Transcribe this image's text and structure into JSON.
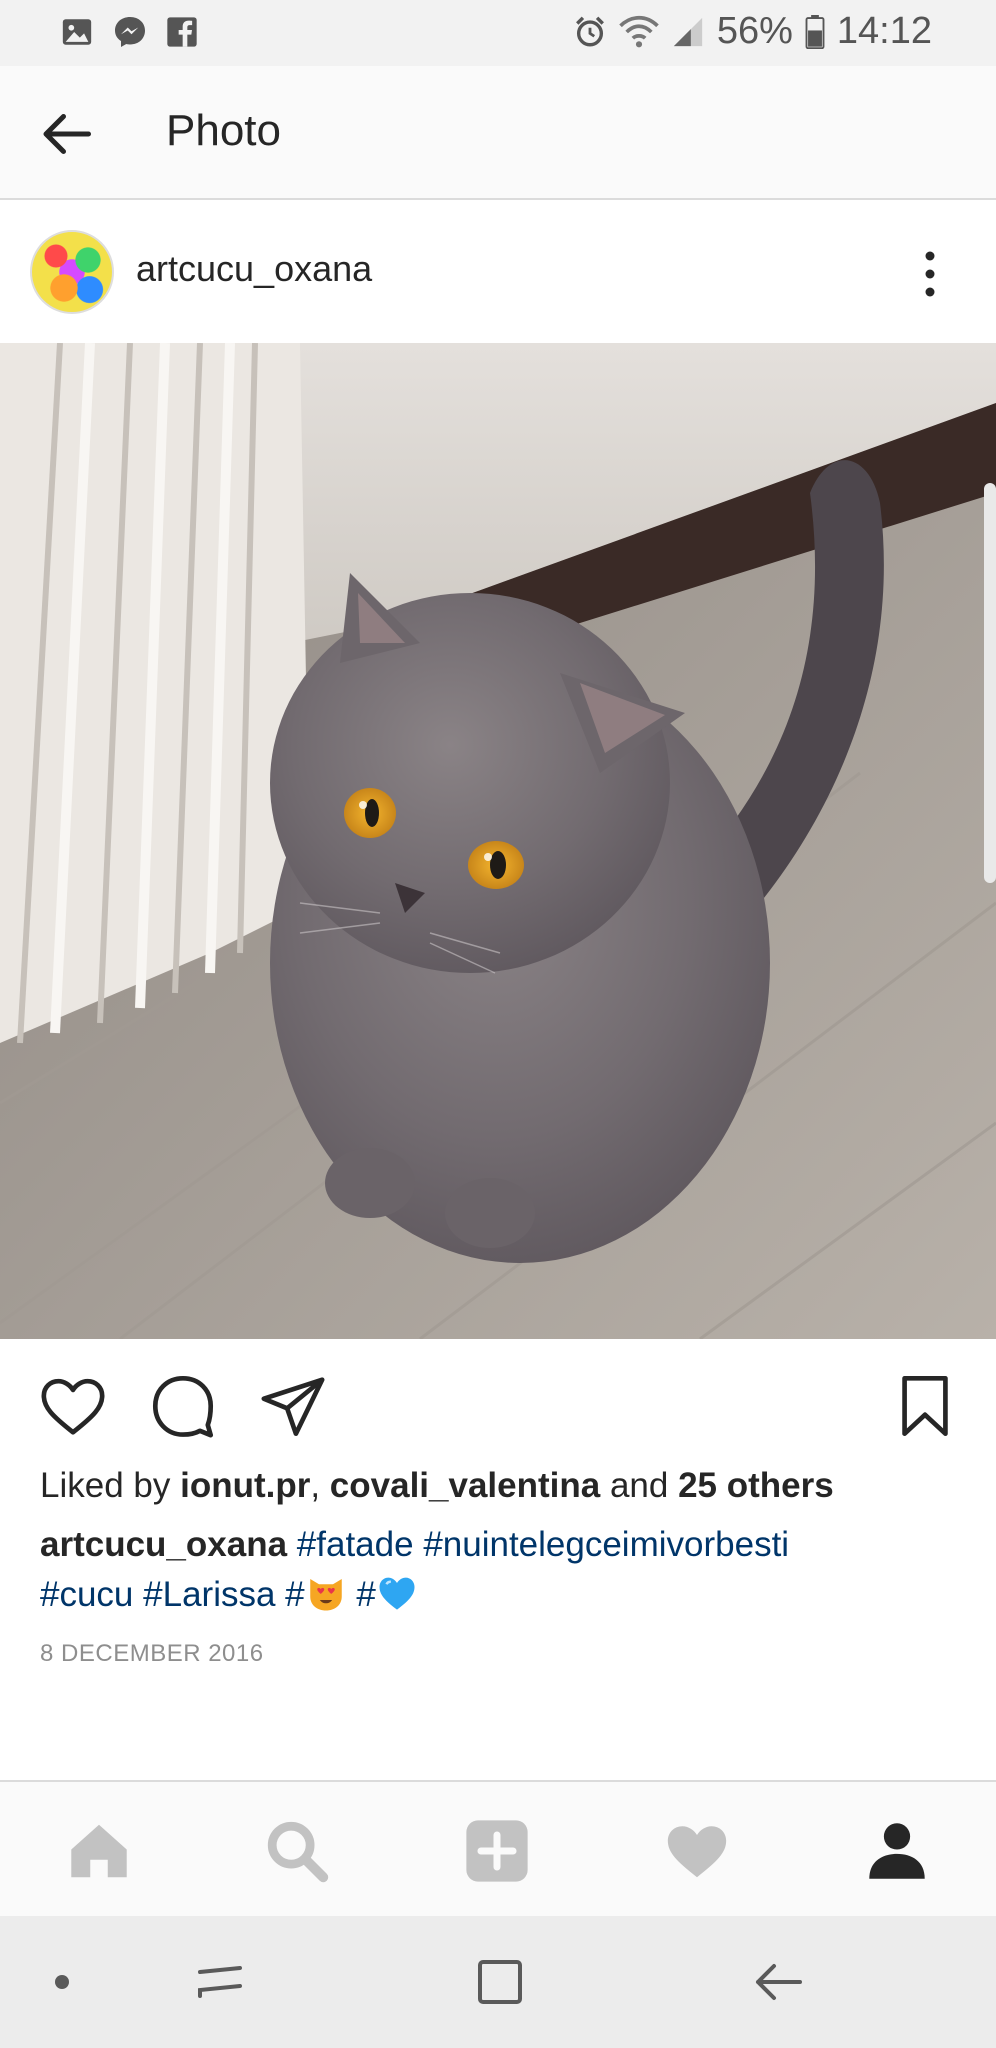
{
  "status_bar": {
    "battery": "56%",
    "time": "14:12",
    "left_icons": [
      "gallery-icon",
      "messenger-icon",
      "facebook-icon"
    ],
    "right_icons": [
      "alarm-icon",
      "wifi-icon",
      "signal-icon",
      "battery-icon"
    ]
  },
  "header": {
    "title": "Photo",
    "back_icon": "arrow-left-icon"
  },
  "post": {
    "username": "artcucu_oxana",
    "more_icon": "vertical-dots-icon",
    "image_subject": "cat",
    "actions": [
      "heart-icon",
      "comment-icon",
      "share-icon",
      "bookmark-icon"
    ],
    "likes": {
      "prefix": "Liked by ",
      "user1": "ionut.pr",
      "sep": ", ",
      "user2": "covali_valentina",
      "and": " and ",
      "others": "25 others"
    },
    "caption": {
      "author": "artcucu_oxana",
      "tags_line1": [
        "#fatade",
        "#nuintelegceimivorbesti"
      ],
      "tags_line2": [
        "#cucu",
        "#Larissa"
      ],
      "emoji_tag_prefix": "#",
      "emoji1": "cat-heart-eyes-emoji",
      "emoji2": "blue-heart-emoji"
    },
    "date": "8 DECEMBER 2016"
  },
  "tabbar": {
    "items": [
      "home-icon",
      "search-icon",
      "add-icon",
      "activity-heart-icon",
      "profile-icon"
    ],
    "active": "profile-icon"
  },
  "navbar": {
    "items": [
      "dot-icon",
      "recents-icon",
      "home-square-icon",
      "back-arrow-icon"
    ]
  },
  "colors": {
    "hashtag": "#003569",
    "text": "#262626",
    "muted": "#8e8e8e",
    "tab_inactive": "#bdbdbd"
  }
}
